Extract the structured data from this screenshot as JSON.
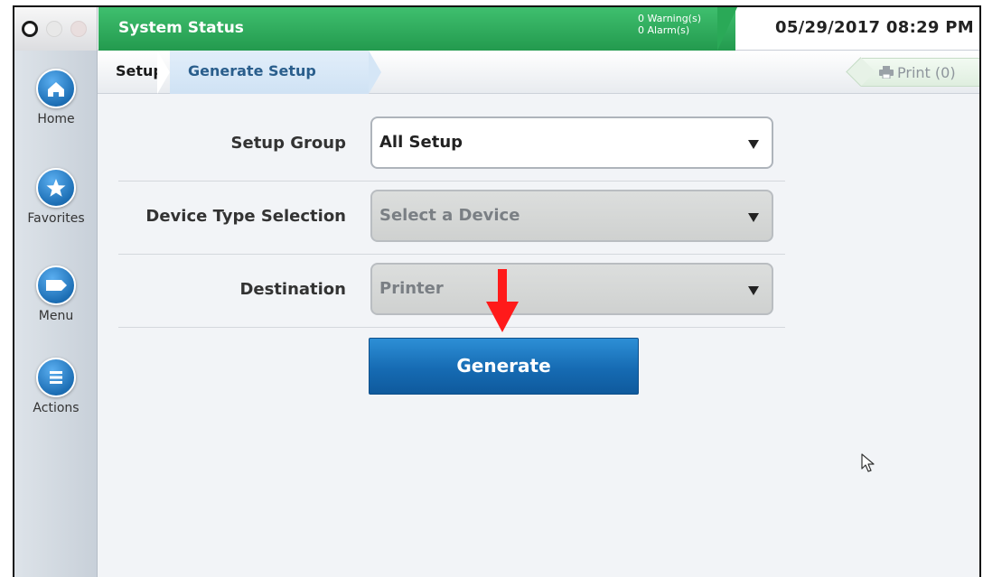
{
  "topbar": {
    "status_title": "System Status",
    "warnings": "0 Warning(s)",
    "alarms": "0 Alarm(s)",
    "datetime": "05/29/2017 08:29 PM",
    "colors": {
      "status_green": "#2aa957"
    }
  },
  "breadcrumb": {
    "root": "Setup",
    "current": "Generate Setup",
    "print_label": "Print (0)"
  },
  "sidebar": {
    "items": [
      {
        "label": "Home",
        "icon": "home-icon"
      },
      {
        "label": "Favorites",
        "icon": "star-icon"
      },
      {
        "label": "Menu",
        "icon": "menu-tag-icon"
      },
      {
        "label": "Actions",
        "icon": "hamburger-icon"
      }
    ]
  },
  "form": {
    "setup_group": {
      "label": "Setup Group",
      "value": "All Setup"
    },
    "device_type": {
      "label": "Device Type Selection",
      "value": "Select a Device"
    },
    "destination": {
      "label": "Destination",
      "value": "Printer"
    },
    "generate_label": "Generate"
  }
}
